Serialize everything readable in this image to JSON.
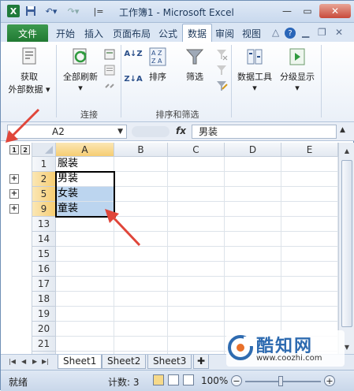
{
  "window": {
    "title": "工作簿1 - Microsoft Excel"
  },
  "quick_access": {
    "separator": "|="
  },
  "tabs": [
    "开始",
    "插入",
    "页面布局",
    "公式",
    "数据",
    "审阅",
    "视图"
  ],
  "file_tab": "文件",
  "active_tab": "数据",
  "ribbon": {
    "get_external_data": [
      "获取",
      "外部数据"
    ],
    "refresh_all": "全部刷新",
    "sort": "排序",
    "filter": "筛选",
    "data_tools": "数据工具",
    "outline": "分级显示",
    "group_connections": "连接",
    "group_sort_filter": "排序和筛选",
    "sort_az": "A↓Z",
    "sort_za": "Z↓A"
  },
  "formula_bar": {
    "name_box": "A2",
    "fx": "fx",
    "value": "男装"
  },
  "outline_levels": [
    "1",
    "2"
  ],
  "columns": [
    "A",
    "B",
    "C",
    "D",
    "E"
  ],
  "rows": [
    {
      "num": "1",
      "a": "服装",
      "collapsed_after": false
    },
    {
      "num": "2",
      "a": "男装",
      "collapsed_after": true
    },
    {
      "num": "5",
      "a": "女装",
      "collapsed_after": true
    },
    {
      "num": "9",
      "a": "童装",
      "collapsed_after": true
    },
    {
      "num": "13",
      "a": ""
    },
    {
      "num": "14",
      "a": ""
    },
    {
      "num": "15",
      "a": ""
    },
    {
      "num": "16",
      "a": ""
    },
    {
      "num": "17",
      "a": ""
    },
    {
      "num": "18",
      "a": ""
    },
    {
      "num": "19",
      "a": ""
    },
    {
      "num": "20",
      "a": ""
    },
    {
      "num": "21",
      "a": ""
    },
    {
      "num": "22",
      "a": ""
    }
  ],
  "expand_symbol": "+",
  "sheets": [
    "Sheet1",
    "Sheet2",
    "Sheet3"
  ],
  "active_sheet": "Sheet1",
  "status": {
    "mode": "就绪",
    "count": "计数: 3",
    "zoom": "100%",
    "minus": "−",
    "plus": "+"
  },
  "watermark": {
    "name": "酷知网",
    "url": "www.coozhi.com"
  },
  "colors": {
    "accent_green": "#217a33",
    "selection": "#bcd5ef",
    "header_selected": "#f6cd72",
    "arrow": "#e0463a"
  }
}
